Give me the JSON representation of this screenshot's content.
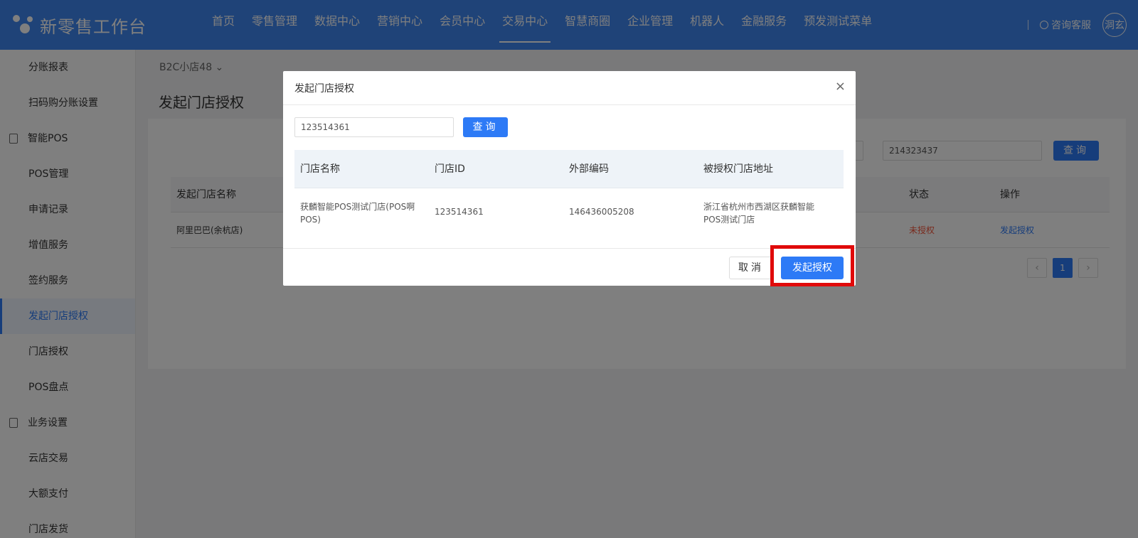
{
  "header": {
    "logo_text": "新零售工作台",
    "nav": [
      "首页",
      "零售管理",
      "数据中心",
      "营销中心",
      "会员中心",
      "交易中心",
      "智慧商圈",
      "企业管理",
      "机器人",
      "金融服务",
      "预发测试菜单"
    ],
    "active_nav": "交易中心",
    "help_text": "咨询客服",
    "avatar_text": "洞玄"
  },
  "sidebar": {
    "items": [
      {
        "label": "分账报表",
        "type": "item"
      },
      {
        "label": "扫码购分账设置",
        "type": "item"
      },
      {
        "label": "智能POS",
        "type": "group"
      },
      {
        "label": "POS管理",
        "type": "item"
      },
      {
        "label": "申请记录",
        "type": "item"
      },
      {
        "label": "增值服务",
        "type": "item"
      },
      {
        "label": "签约服务",
        "type": "item"
      },
      {
        "label": "发起门店授权",
        "type": "item",
        "active": true
      },
      {
        "label": "门店授权",
        "type": "item"
      },
      {
        "label": "POS盘点",
        "type": "item"
      },
      {
        "label": "业务设置",
        "type": "group"
      },
      {
        "label": "云店交易",
        "type": "item"
      },
      {
        "label": "大额支付",
        "type": "item"
      },
      {
        "label": "门店发货",
        "type": "item"
      }
    ]
  },
  "main": {
    "store_select": "B2C小店48 ⌄",
    "page_title": "发起门店授权",
    "filter_input_value": "214323437",
    "filter_button": "查询",
    "table_headers": [
      "发起门店名称",
      "状态",
      "操作"
    ],
    "row": {
      "store_name": "阿里巴巴(余杭店)",
      "status": "未授权",
      "action": "发起授权"
    },
    "pager_current": "1"
  },
  "modal": {
    "title": "发起门店授权",
    "close_icon": "×",
    "search_value": "123514361",
    "search_button": "查询",
    "headers": [
      "门店名称",
      "门店ID",
      "外部编码",
      "被授权门店地址"
    ],
    "rows": [
      {
        "name": "获麟智能POS测试门店(POS啊POS)",
        "id": "123514361",
        "external_code": "146436005208",
        "address": "浙江省杭州市西湖区获麟智能POS测试门店"
      }
    ],
    "cancel_button": "取消",
    "confirm_button": "发起授权"
  },
  "colors": {
    "header_bg": "#3f86f0",
    "primary": "#2d7af6",
    "danger": "#f5553b",
    "highlight_box": "#e00a0a"
  }
}
